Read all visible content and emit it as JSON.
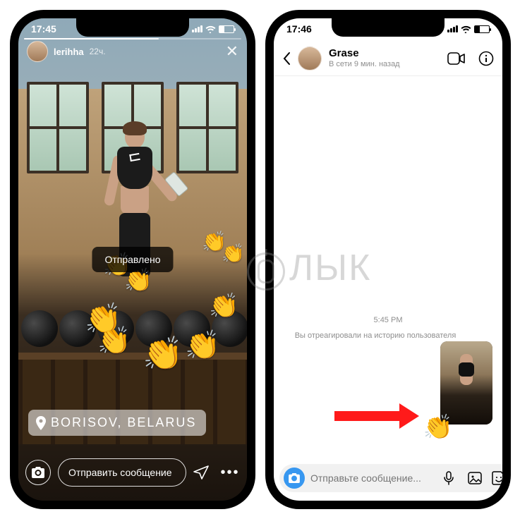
{
  "watermark_text": "ЛЫК",
  "left": {
    "status_time": "17:45",
    "username": "lerihha",
    "story_age": "22ч.",
    "toast": "Отправлено",
    "location": "BORISOV, BELARUS",
    "message_placeholder": "Отправить сообщение"
  },
  "right": {
    "status_time": "17:46",
    "chat_name": "Grase",
    "chat_status": "В сети 9 мин. назад",
    "timestamp": "5:45 PM",
    "reaction_label": "Вы отреагировали на историю пользователя",
    "reaction_emoji": "👏",
    "message_placeholder": "Отправьте сообщение..."
  }
}
